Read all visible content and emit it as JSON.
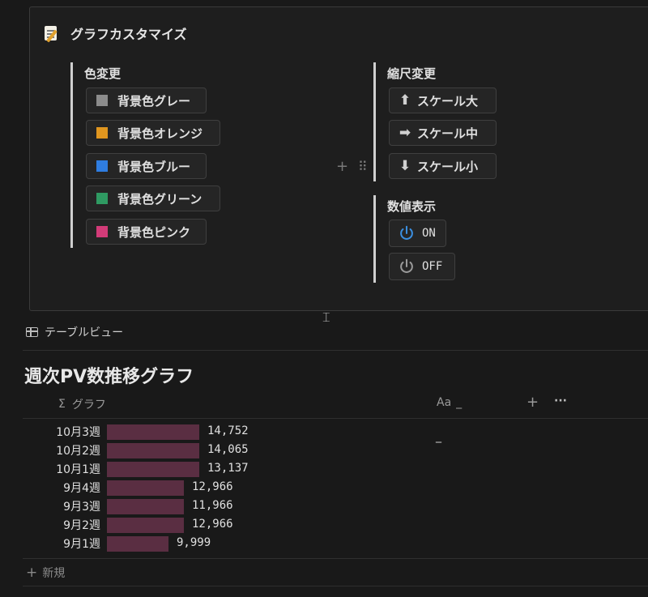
{
  "panel": {
    "title": "グラフカスタマイズ",
    "color_group": {
      "title": "色変更",
      "buttons": [
        {
          "label": "背景色グレー",
          "color": "#8c8c8c"
        },
        {
          "label": "背景色オレンジ",
          "color": "#e0961f"
        },
        {
          "label": "背景色ブルー",
          "color": "#2f7de1"
        },
        {
          "label": "背景色グリーン",
          "color": "#2f9a62"
        },
        {
          "label": "背景色ピンク",
          "color": "#d23b78"
        }
      ]
    },
    "scale_group": {
      "title": "縮尺変更",
      "buttons": [
        {
          "label": "スケール大",
          "icon": "arrow-up-icon",
          "glyph": "⬆"
        },
        {
          "label": "スケール中",
          "icon": "arrow-right-icon",
          "glyph": "➡"
        },
        {
          "label": "スケール小",
          "icon": "arrow-down-icon",
          "glyph": "⬇"
        }
      ]
    },
    "value_group": {
      "title": "数値表示",
      "on_label": "ON",
      "off_label": "OFF",
      "on_color": "#3b8fe0",
      "off_color": "#9a9a9a"
    }
  },
  "view_tab": {
    "label": "テーブルビュー"
  },
  "database": {
    "title": "週次PV数推移グラフ",
    "columns": {
      "graph": {
        "icon": "sigma-icon",
        "glyph": "Σ",
        "label": "グラフ"
      },
      "name": {
        "icon": "text-property-icon",
        "glyph": "Aa",
        "label": "_"
      }
    },
    "add_glyph": "+",
    "more_glyph": "···",
    "name_cell": "_",
    "bar_color": "#5a2e42",
    "rows": [
      {
        "label": "10月3週",
        "value": 14752,
        "display": "14,752",
        "bar_units": 6
      },
      {
        "label": "10月2週",
        "value": 14065,
        "display": "14,065",
        "bar_units": 6
      },
      {
        "label": "10月1週",
        "value": 13137,
        "display": "13,137",
        "bar_units": 6
      },
      {
        "label": "9月4週",
        "value": 12966,
        "display": "12,966",
        "bar_units": 5
      },
      {
        "label": "9月3週",
        "value": 11966,
        "display": "11,966",
        "bar_units": 5
      },
      {
        "label": "9月2週",
        "value": 12966,
        "display": "12,966",
        "bar_units": 5
      },
      {
        "label": "9月1週",
        "value": 9999,
        "display": "9,999",
        "bar_units": 4
      }
    ]
  },
  "new_row": {
    "glyph": "+",
    "label": "新規"
  }
}
